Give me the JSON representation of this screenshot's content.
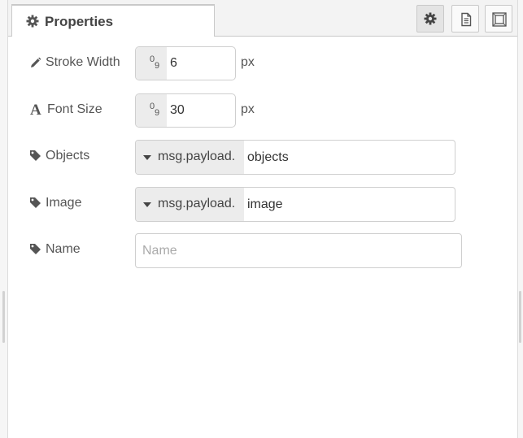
{
  "tabs": [
    {
      "label": "Properties",
      "icon": "gear-icon"
    }
  ],
  "toolbar": {
    "buttons": [
      {
        "icon": "gear-icon",
        "active": true
      },
      {
        "icon": "document-icon",
        "active": false
      },
      {
        "icon": "frame-icon",
        "active": false
      }
    ]
  },
  "form": {
    "stroke_width": {
      "label": "Stroke Width",
      "icon": "pencil-icon",
      "value": "6",
      "unit": "px"
    },
    "font_size": {
      "label": "Font Size",
      "icon": "font-icon",
      "value": "30",
      "unit": "px"
    },
    "objects": {
      "label": "Objects",
      "icon": "tag-icon",
      "type": "msg.payload.",
      "value": "objects"
    },
    "image": {
      "label": "Image",
      "icon": "tag-icon",
      "type": "msg.payload.",
      "value": "image"
    },
    "name": {
      "label": "Name",
      "icon": "tag-icon",
      "value": "",
      "placeholder": "Name"
    }
  },
  "colors": {
    "accent_bg": "#ececec",
    "border": "#cfcfcf",
    "text": "#555555"
  }
}
